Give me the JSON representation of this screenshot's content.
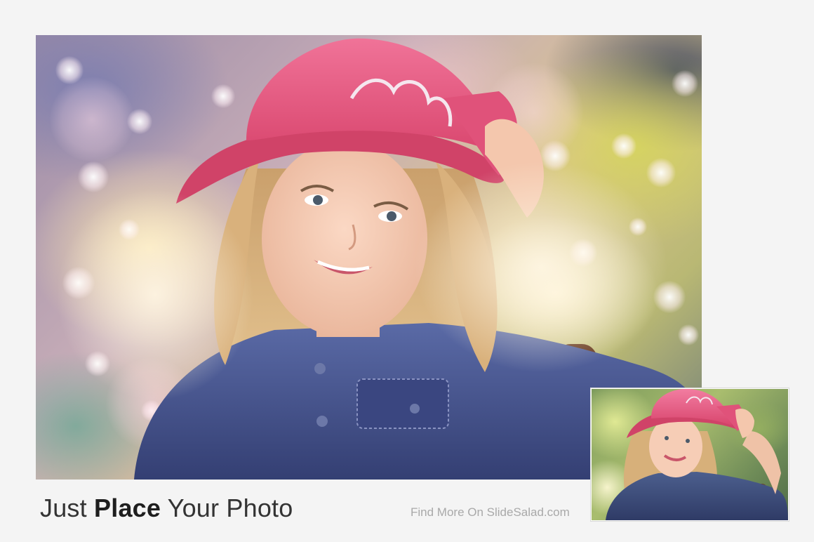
{
  "headline": {
    "part1": "Just ",
    "emphasis": "Place",
    "part2": " Your Photo"
  },
  "footer": {
    "link_text": "Find More On SlideSalad.com"
  },
  "colors": {
    "background": "#f4f4f4",
    "headline_text": "#2a2a2a",
    "footer_text": "#a9a9a9",
    "hat_pink": "#e8577f",
    "shirt_denim": "#3f4f86"
  },
  "images": {
    "main": "girl-in-pink-hat-photo-with-bokeh-effect",
    "thumbnail": "girl-in-pink-hat-original-photo"
  }
}
